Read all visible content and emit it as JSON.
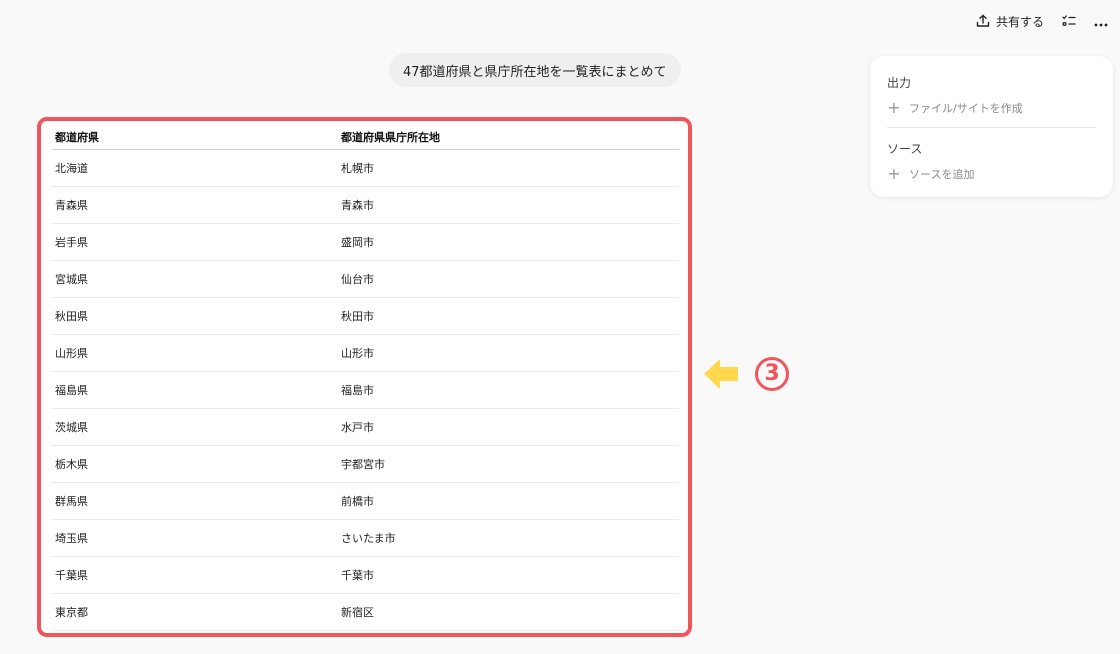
{
  "toolbar": {
    "share_label": "共有する",
    "share_icon": "upload-icon",
    "tasks_icon": "task-list-icon",
    "more_icon": "more-horizontal-icon"
  },
  "message": {
    "text": "47都道府県と県庁所在地を一覧表にまとめて"
  },
  "panel": {
    "output_heading": "出力",
    "output_action": "ファイル/サイトを作成",
    "sources_heading": "ソース",
    "sources_action": "ソースを追加"
  },
  "table": {
    "headers": [
      "都道府県",
      "都道府県県庁所在地"
    ],
    "rows": [
      [
        "北海道",
        "札幌市"
      ],
      [
        "青森県",
        "青森市"
      ],
      [
        "岩手県",
        "盛岡市"
      ],
      [
        "宮城県",
        "仙台市"
      ],
      [
        "秋田県",
        "秋田市"
      ],
      [
        "山形県",
        "山形市"
      ],
      [
        "福島県",
        "福島市"
      ],
      [
        "茨城県",
        "水戸市"
      ],
      [
        "栃木県",
        "宇都宮市"
      ],
      [
        "群馬県",
        "前橋市"
      ],
      [
        "埼玉県",
        "さいたま市"
      ],
      [
        "千葉県",
        "千葉市"
      ],
      [
        "東京都",
        "新宿区"
      ]
    ]
  },
  "annotation": {
    "number": "3",
    "arrow_color": "#ffd84d",
    "highlight_color": "#f0555c"
  }
}
